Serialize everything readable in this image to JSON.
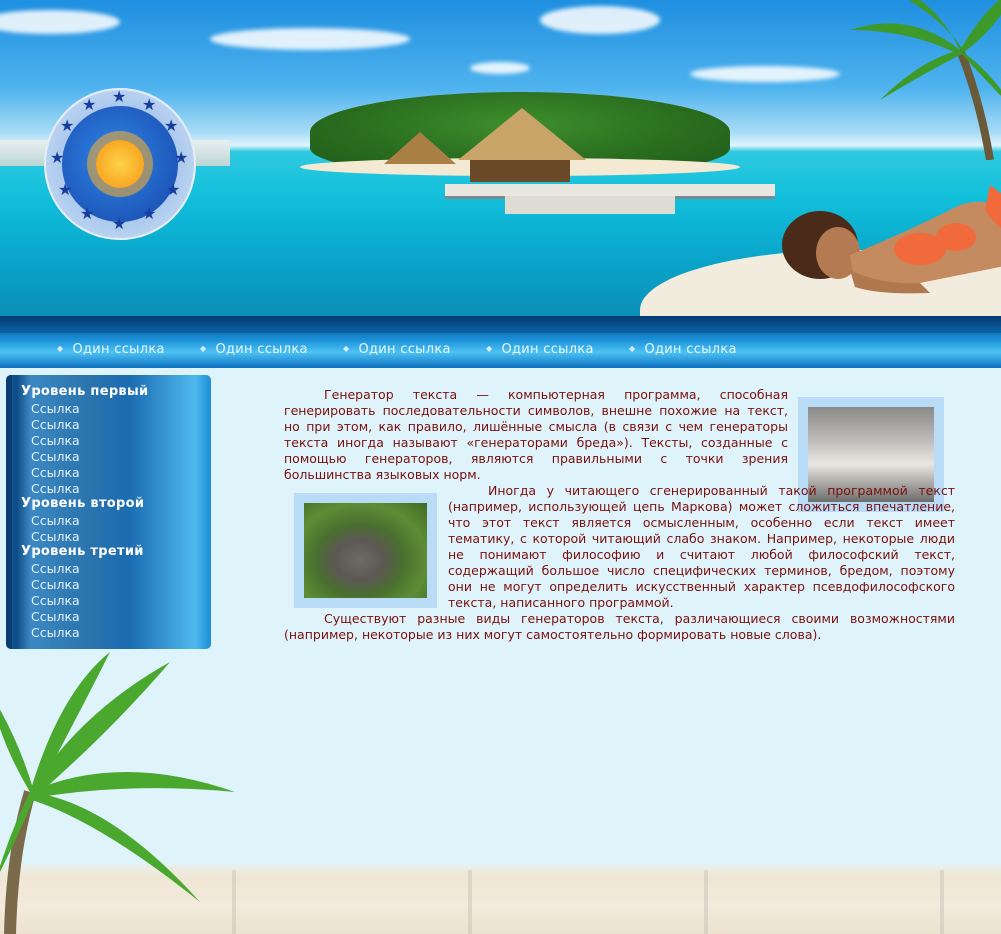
{
  "nav": {
    "items": [
      {
        "label": "Один ссылка"
      },
      {
        "label": "Один ссылка"
      },
      {
        "label": "Один ссылка"
      },
      {
        "label": "Один ссылка"
      },
      {
        "label": "Один ссылка"
      }
    ]
  },
  "sidebar": {
    "groups": [
      {
        "title": "Уровень первый",
        "links": [
          "Ссылка",
          "Ссылка",
          "Ссылка",
          "Ссылка",
          "Ссылка",
          "Ссылка"
        ]
      },
      {
        "title": "Уровень второй",
        "links": [
          "Ссылка",
          "Ссылка"
        ]
      },
      {
        "title": "Уровень третий",
        "links": [
          "Ссылка",
          "Ссылка",
          "Ссылка",
          "Ссылка",
          "Ссылка"
        ]
      }
    ]
  },
  "content": {
    "para1": "Генератор текста — компьютерная программа, способная генерировать последовательности символов, внешне похожие на текст, но при этом, как правило, лишённые смысла (в связи с чем генераторы текста иногда называют «генераторами бреда»). Тексты, созданные с помощью генераторов, являются правильными с точки зрения большинства языковых норм.",
    "para2": "Иногда у читающего сгенерированный такой программой текст (например, использующей цепь Маркова) может сложиться впечатление, что этот текст является осмысленным, особенно если текст имеет тематику, с которой читающий слабо знаком. Например, некоторые люди не понимают философию и считают любой философский текст, содержащий большое число специфических терминов, бредом, поэтому они не могут определить искусственный характер псевдофилософского текста, написанного программой.",
    "para3": "Существуют разные виды генераторов текста, различающиеся своими возможностями (например, некоторые из них могут самостоятельно формировать новые слова)."
  },
  "colors": {
    "text": "#7a1010",
    "background": "#dff3fb",
    "nav": "#1a8fd8"
  },
  "icons": {
    "logo": "sun-logo-icon",
    "nav_bullet": "bullet-icon"
  }
}
